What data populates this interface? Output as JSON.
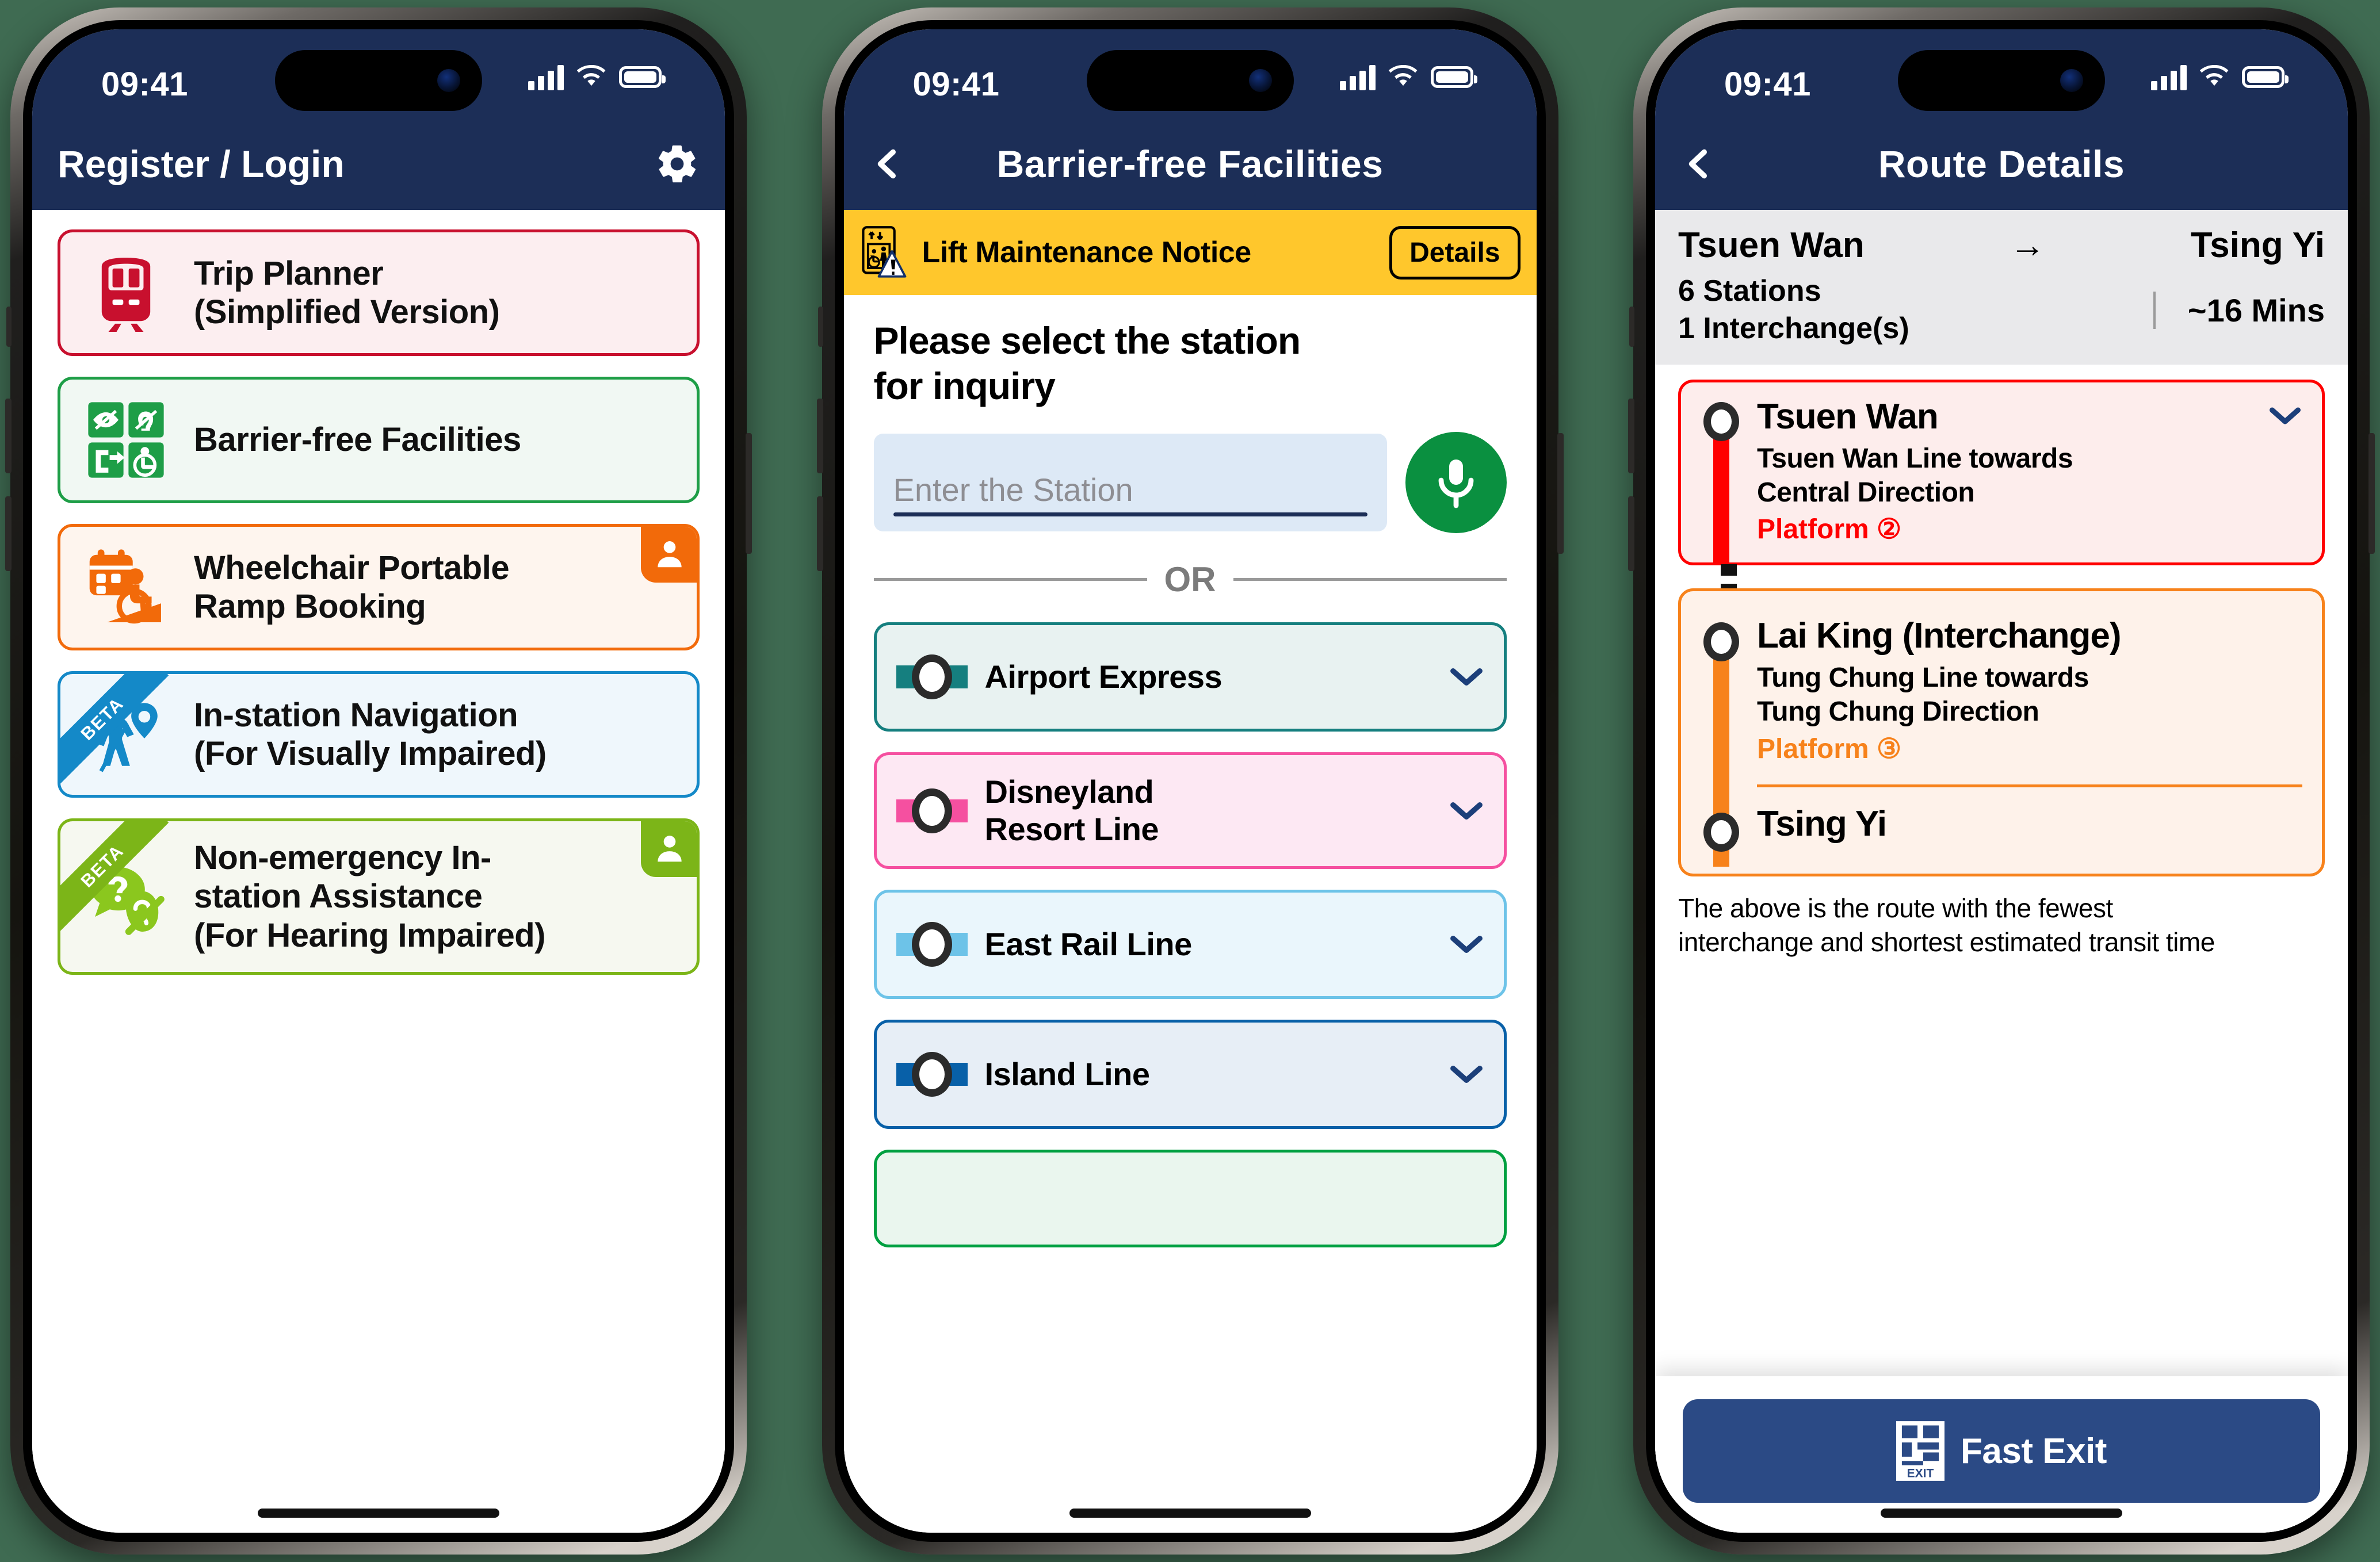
{
  "status_bar": {
    "time": "09:41",
    "signal_icon": "cellular-bars-icon",
    "wifi_icon": "wifi-icon",
    "battery_icon": "battery-icon"
  },
  "colors": {
    "navy": "#1c2e57",
    "red": "#C8102E",
    "green": "#0A9040",
    "orange": "#F26A0A",
    "blue": "#1489C8",
    "lightgreen": "#7CB518",
    "yellow": "#FFC72C",
    "tsuen_wan_line": "#FF0000",
    "tung_chung_line": "#F7821B",
    "airport_express": "#157F7F",
    "disneyland_resort_line": "#F550A0",
    "east_rail_line": "#6DC3E8",
    "island_line": "#0860A8",
    "kwun_tong_line": "#00A040"
  },
  "screen1": {
    "nav": {
      "title": "Register / Login",
      "settings_icon": "gear-icon"
    },
    "cards": [
      {
        "label": "Trip Planner\n(Simplified Version)",
        "line1": "Trip Planner",
        "line2": "(Simplified Version)",
        "icon": "metro-train-icon",
        "border": "#C8102E",
        "bg": "#FCEEF0",
        "badge": null,
        "ribbon": null
      },
      {
        "label": "Barrier-free Facilities",
        "line1": "Barrier-free Facilities",
        "line2": "",
        "icon": "accessibility-grid-icon",
        "border": "#1E9E47",
        "bg": "#F1F8F3",
        "badge": null,
        "ribbon": null
      },
      {
        "label": "Wheelchair Portable\nRamp Booking",
        "line1": "Wheelchair Portable",
        "line2": "Ramp Booking",
        "icon": "wheelchair-ramp-booking-icon",
        "border": "#F26A0A",
        "bg": "#FEF5EE",
        "badge": "person-badge-icon",
        "badge_color": "#F26A0A",
        "ribbon": null
      },
      {
        "label": "In-station Navigation\n(For Visually Impaired)",
        "line1": "In-station Navigation",
        "line2": "(For Visually Impaired)",
        "icon": "blind-navigation-pin-icon",
        "border": "#1489C8",
        "bg": "#EFF7FC",
        "badge": null,
        "ribbon": "BETA",
        "ribbon_color": "#1489C8"
      },
      {
        "label": "Non-emergency In-station Assistance\n(For Hearing Impaired)",
        "line1": "Non-emergency In-",
        "line2": "station Assistance",
        "line3": "(For Hearing Impaired)",
        "icon": "hearing-help-chat-icon",
        "border": "#7CB518",
        "bg": "#F6F8F0",
        "badge": "person-badge-icon",
        "badge_color": "#7CB518",
        "ribbon": "BETA",
        "ribbon_color": "#7CB518"
      }
    ]
  },
  "screen2": {
    "nav": {
      "back_icon": "chevron-left-icon",
      "title": "Barrier-free Facilities"
    },
    "notice": {
      "icon": "lift-maintenance-warning-icon",
      "text": "Lift Maintenance Notice",
      "button_label": "Details"
    },
    "heading_line1": "Please select the station",
    "heading_line2": "for inquiry",
    "search": {
      "placeholder": "Enter the Station",
      "value": "",
      "mic_icon": "microphone-icon"
    },
    "divider_label": "OR",
    "lines": [
      {
        "name": "Airport Express",
        "name2": "",
        "color": "#157F7F",
        "border": "#157F7F",
        "bg": "#E8F2F1",
        "chevron": "chevron-down-icon"
      },
      {
        "name": "Disneyland",
        "name2": "Resort Line",
        "color": "#F550A0",
        "border": "#F550A0",
        "bg": "#FDE8F3",
        "chevron": "chevron-down-icon"
      },
      {
        "name": "East Rail Line",
        "name2": "",
        "color": "#6DC3E8",
        "border": "#6DC3E8",
        "bg": "#EAF6FC",
        "chevron": "chevron-down-icon"
      },
      {
        "name": "Island Line",
        "name2": "",
        "color": "#0860A8",
        "border": "#0860A8",
        "bg": "#E7EEF6",
        "chevron": "chevron-down-icon"
      },
      {
        "name": "",
        "name2": "",
        "color": "#00A040",
        "border": "#00A040",
        "bg": "#EAF6EE",
        "chevron": "chevron-down-icon"
      }
    ]
  },
  "screen3": {
    "nav": {
      "back_icon": "chevron-left-icon",
      "title": "Route Details"
    },
    "summary": {
      "origin": "Tsuen Wan",
      "arrow": "→",
      "destination": "Tsing Yi",
      "stations": "6 Stations",
      "interchanges": "1 Interchange(s)",
      "duration": "~16 Mins"
    },
    "segments": [
      {
        "station": "Tsuen Wan",
        "line_info_1": "Tsuen Wan Line towards",
        "line_info_2": "Central Direction",
        "platform": "Platform ②",
        "color": "#FF0000",
        "border": "#FF0000",
        "bg": "#FDEDEC",
        "chevron": "chevron-down-icon"
      },
      {
        "station": "Lai King (Interchange)",
        "line_info_1": "Tung Chung Line towards",
        "line_info_2": "Tung Chung Direction",
        "platform": "Platform ③",
        "color": "#F7821B",
        "border": "#F7821B",
        "bg": "#FEF2EA",
        "end_station": "Tsing Yi",
        "chevron": null
      }
    ],
    "note_line1": "The above is the route with the fewest",
    "note_line2": "interchange and shortest estimated transit time",
    "fast_exit": {
      "label": "Fast Exit",
      "icon": "exit-sign-icon",
      "icon_text": "EXIT"
    }
  }
}
